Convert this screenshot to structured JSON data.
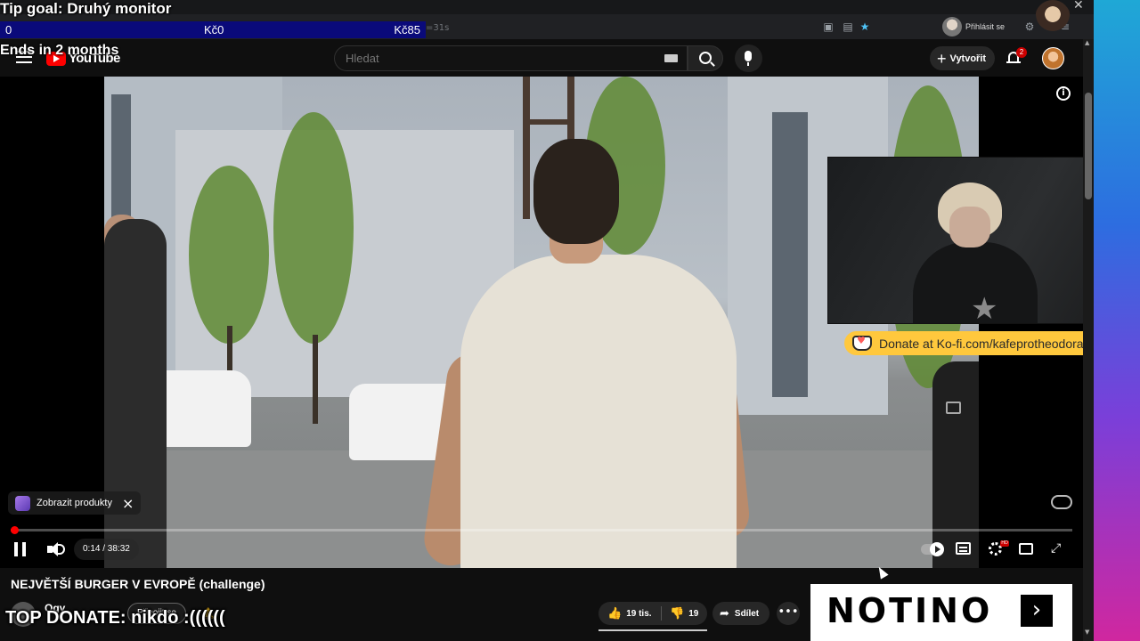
{
  "overlay": {
    "tip_goal": "Tip goal: Druhý monitor",
    "goal_start": "0",
    "goal_current": "Kč0",
    "goal_target": "Kč85",
    "goal_progress": 0.0,
    "ends_in": "Ends in 2 months",
    "top_donate": "TOP DONATE: nikdo :(((((("
  },
  "browser": {
    "url_fragment": "=31s",
    "login_label": "Přihlásit se",
    "icons": [
      "screenshot-icon",
      "reading-list-icon",
      "bookmark-star-icon",
      "extensions-icon",
      "menu-icon"
    ]
  },
  "youtube_header": {
    "logo_text": "YouTube",
    "search_placeholder": "Hledat",
    "create_label": "Vytvořit",
    "notification_count": "2"
  },
  "player": {
    "current_time": "0:14",
    "duration": "38:32",
    "time_display": "0:14 / 38:32",
    "progress": 0.006,
    "product_chip_label": "Zobrazit produkty",
    "settings_badge": "HD"
  },
  "kofi": {
    "text": "Donate at Ko-fi.com/kafeprotheodora",
    "accent": "#ffc83d"
  },
  "video": {
    "title": "NEJVĚTŠÍ BURGER V EVROPĚ (challenge)",
    "channel_name": "Ogy",
    "join_label": "Připojit se",
    "likes": "19 tis.",
    "dislikes": "19",
    "share_label": "Sdílet"
  },
  "ad": {
    "brand": "NOTINO",
    "arrow": "›"
  },
  "colors": {
    "yt_red": "#ff0000",
    "goal_bar": "#0a0a7a",
    "page_bg": "#0f0f0f"
  }
}
